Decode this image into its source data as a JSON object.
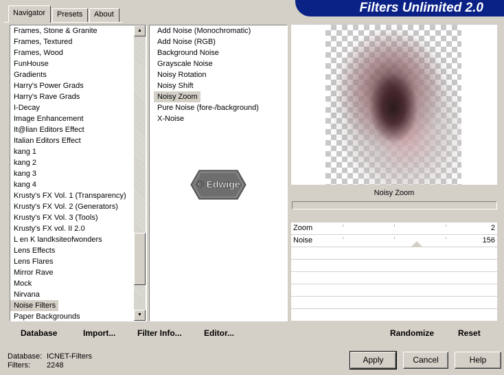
{
  "tabs": [
    {
      "label": "Navigator",
      "active": true
    },
    {
      "label": "Presets",
      "active": false
    },
    {
      "label": "About",
      "active": false
    }
  ],
  "banner": {
    "title": "Filters Unlimited 2.0",
    "color": "#0a2286"
  },
  "categories": {
    "items": [
      "Frames, Stone & Granite",
      "Frames, Textured",
      "Frames, Wood",
      "FunHouse",
      "Gradients",
      "Harry's Power Grads",
      "Harry's Rave Grads",
      "I-Decay",
      "Image Enhancement",
      "It@lian Editors Effect",
      "Italian Editors Effect",
      "kang 1",
      "kang 2",
      "kang 3",
      "kang 4",
      "Krusty's FX Vol. 1 (Transparency)",
      "Krusty's FX Vol. 2 (Generators)",
      "Krusty's FX Vol. 3 (Tools)",
      "Krusty's FX vol. II 2.0",
      "L en K landksiteofwonders",
      "Lens Effects",
      "Lens Flares",
      "Mirror Rave",
      "Mock",
      "Nirvana",
      "Noise Filters",
      "Paper Backgrounds"
    ],
    "selected_index": 25,
    "scroll_up_icon": "triangle-up-icon",
    "scroll_down_icon": "triangle-down-icon"
  },
  "filters": {
    "items": [
      "Add Noise (Monochromatic)",
      "Add Noise (RGB)",
      "Background Noise",
      "Grayscale Noise",
      "Noisy Rotation",
      "Noisy Shift",
      "Noisy Zoom",
      "Pure Noise (fore-/background)",
      "X-Noise"
    ],
    "selected_index": 6
  },
  "watermark": {
    "text": "© Edwige"
  },
  "preview": {
    "filter_name": "Noisy Zoom"
  },
  "params": [
    {
      "name": "Zoom",
      "value": "2",
      "fraction": 0.0
    },
    {
      "name": "Noise",
      "value": "156",
      "fraction": 0.61
    }
  ],
  "toolbar": {
    "database": "Database",
    "import": "Import...",
    "filter_info": "Filter Info...",
    "editor": "Editor...",
    "randomize": "Randomize",
    "reset": "Reset"
  },
  "info": {
    "database_label": "Database:",
    "database_value": "ICNET-Filters",
    "filters_label": "Filters:",
    "filters_value": "2248"
  },
  "buttons": {
    "apply": "Apply",
    "cancel": "Cancel",
    "help": "Help"
  }
}
